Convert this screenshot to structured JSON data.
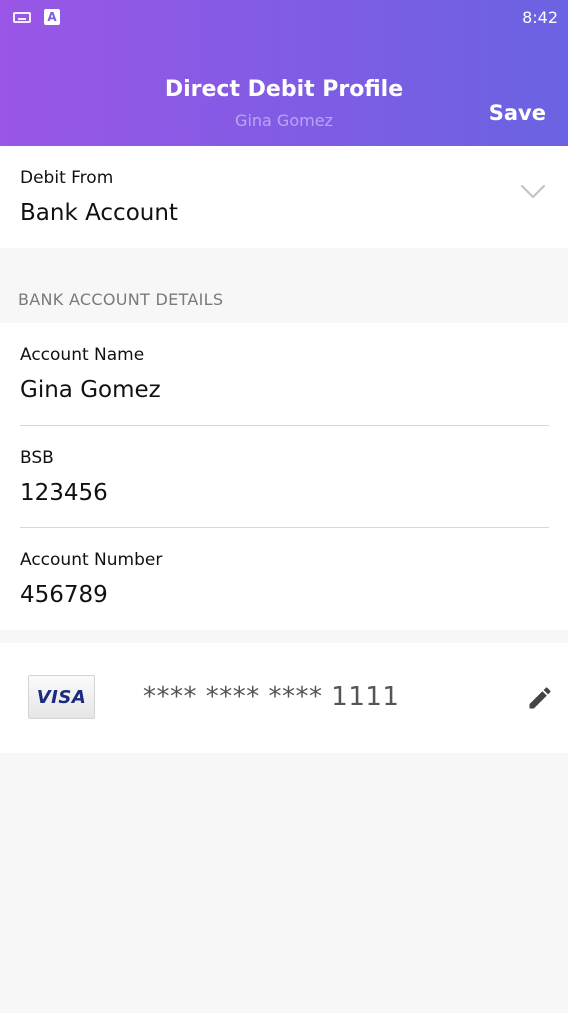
{
  "status_bar": {
    "time": "8:42",
    "a_glyph": "A"
  },
  "header": {
    "title": "Direct Debit Profile",
    "subtitle": "Gina Gomez",
    "save_label": "Save"
  },
  "debit_from": {
    "label": "Debit From",
    "value": "Bank Account"
  },
  "bank_details": {
    "section_title": "BANK ACCOUNT DETAILS",
    "fields": [
      {
        "label": "Account Name",
        "value": "Gina Gomez"
      },
      {
        "label": "BSB",
        "value": "123456"
      },
      {
        "label": "Account Number",
        "value": "456789"
      }
    ]
  },
  "card": {
    "brand": "VISA",
    "masked_number": "**** **** **** 1111"
  },
  "colors": {
    "header_gradient_start": "#9a56e6",
    "header_gradient_end": "#6a63e2",
    "background": "#f7f7f7",
    "visa_blue": "#1a2c7f"
  },
  "icons": {
    "keyboard": "keyboard-icon",
    "android_a": "a-icon",
    "dropdown": "chevron-down-icon",
    "edit": "pencil-icon"
  }
}
